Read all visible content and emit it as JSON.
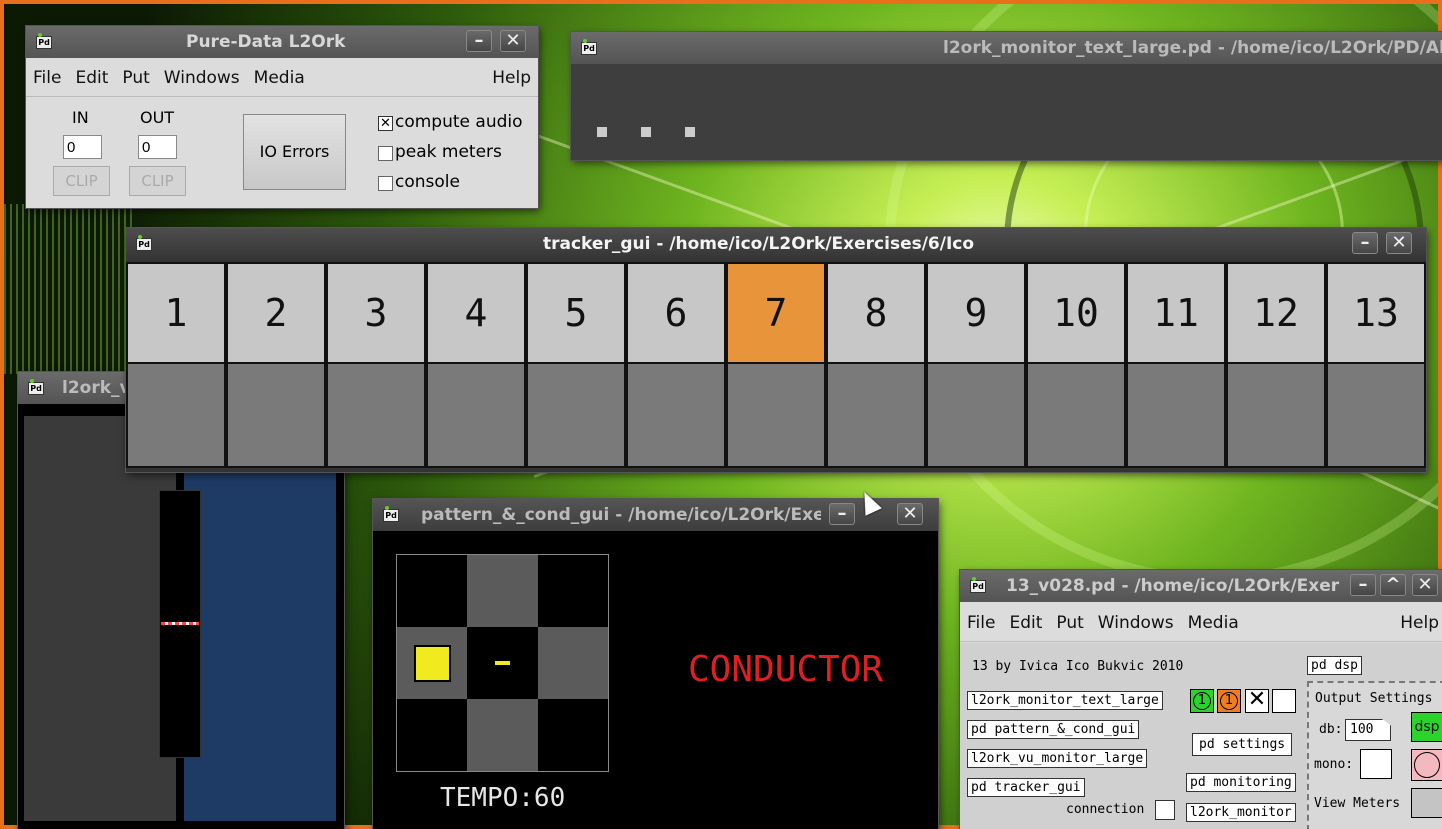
{
  "main_window": {
    "title": "Pure-Data L2Ork",
    "menu": [
      "File",
      "Edit",
      "Put",
      "Windows",
      "Media"
    ],
    "help": "Help",
    "in_label": "IN",
    "out_label": "OUT",
    "in_value": "0",
    "out_value": "0",
    "clip_in": "CLIP",
    "clip_out": "CLIP",
    "io_errors": "IO Errors",
    "compute_audio": "compute audio",
    "peak_meters": "peak meters",
    "console": "console",
    "compute_audio_checked": true,
    "peak_meters_checked": false,
    "console_checked": false
  },
  "monitor_window": {
    "title": "l2ork_monitor_text_large.pd  - /home/ico/L2Ork/PD/Al"
  },
  "vu_window": {
    "title": "l2ork_v"
  },
  "tracker_window": {
    "title": "tracker_gui  - /home/ico/L2Ork/Exercises/6/Ico",
    "columns": [
      "1",
      "2",
      "3",
      "4",
      "5",
      "6",
      "7",
      "8",
      "9",
      "10",
      "11",
      "12",
      "13"
    ],
    "active_column": "7",
    "active_color": "#e8943a"
  },
  "pattern_window": {
    "title": "pattern_&_cond_gui  - /home/ico/L2Ork/Exe",
    "conductor": "CONDUCTOR",
    "tempo": "TEMPO:60",
    "conductor_color": "#e02020"
  },
  "patch_window": {
    "title": "13_v028.pd  - /home/ico/L2Ork/Exer",
    "menu": [
      "File",
      "Edit",
      "Put",
      "Windows",
      "Media"
    ],
    "help": "Help",
    "credit": "13 by Ivica Ico Bukvic 2010",
    "pd_dsp": "pd dsp",
    "objects_left": [
      "l2ork_monitor_text_large",
      "pd pattern_&_cond_gui",
      "l2ork_vu_monitor_large",
      "pd tracker_gui"
    ],
    "connection": "connection",
    "pd_settings": "pd settings",
    "pd_monitoring": "pd monitoring",
    "l2ork_monitor": "l2ork_monitor",
    "output_settings": "Output Settings",
    "db_label": "db:",
    "db_value": "100",
    "dsp": "dsp",
    "mono_label": "mono:",
    "view_meters": "View Meters",
    "toggle_1a": "1",
    "toggle_1b": "1"
  }
}
